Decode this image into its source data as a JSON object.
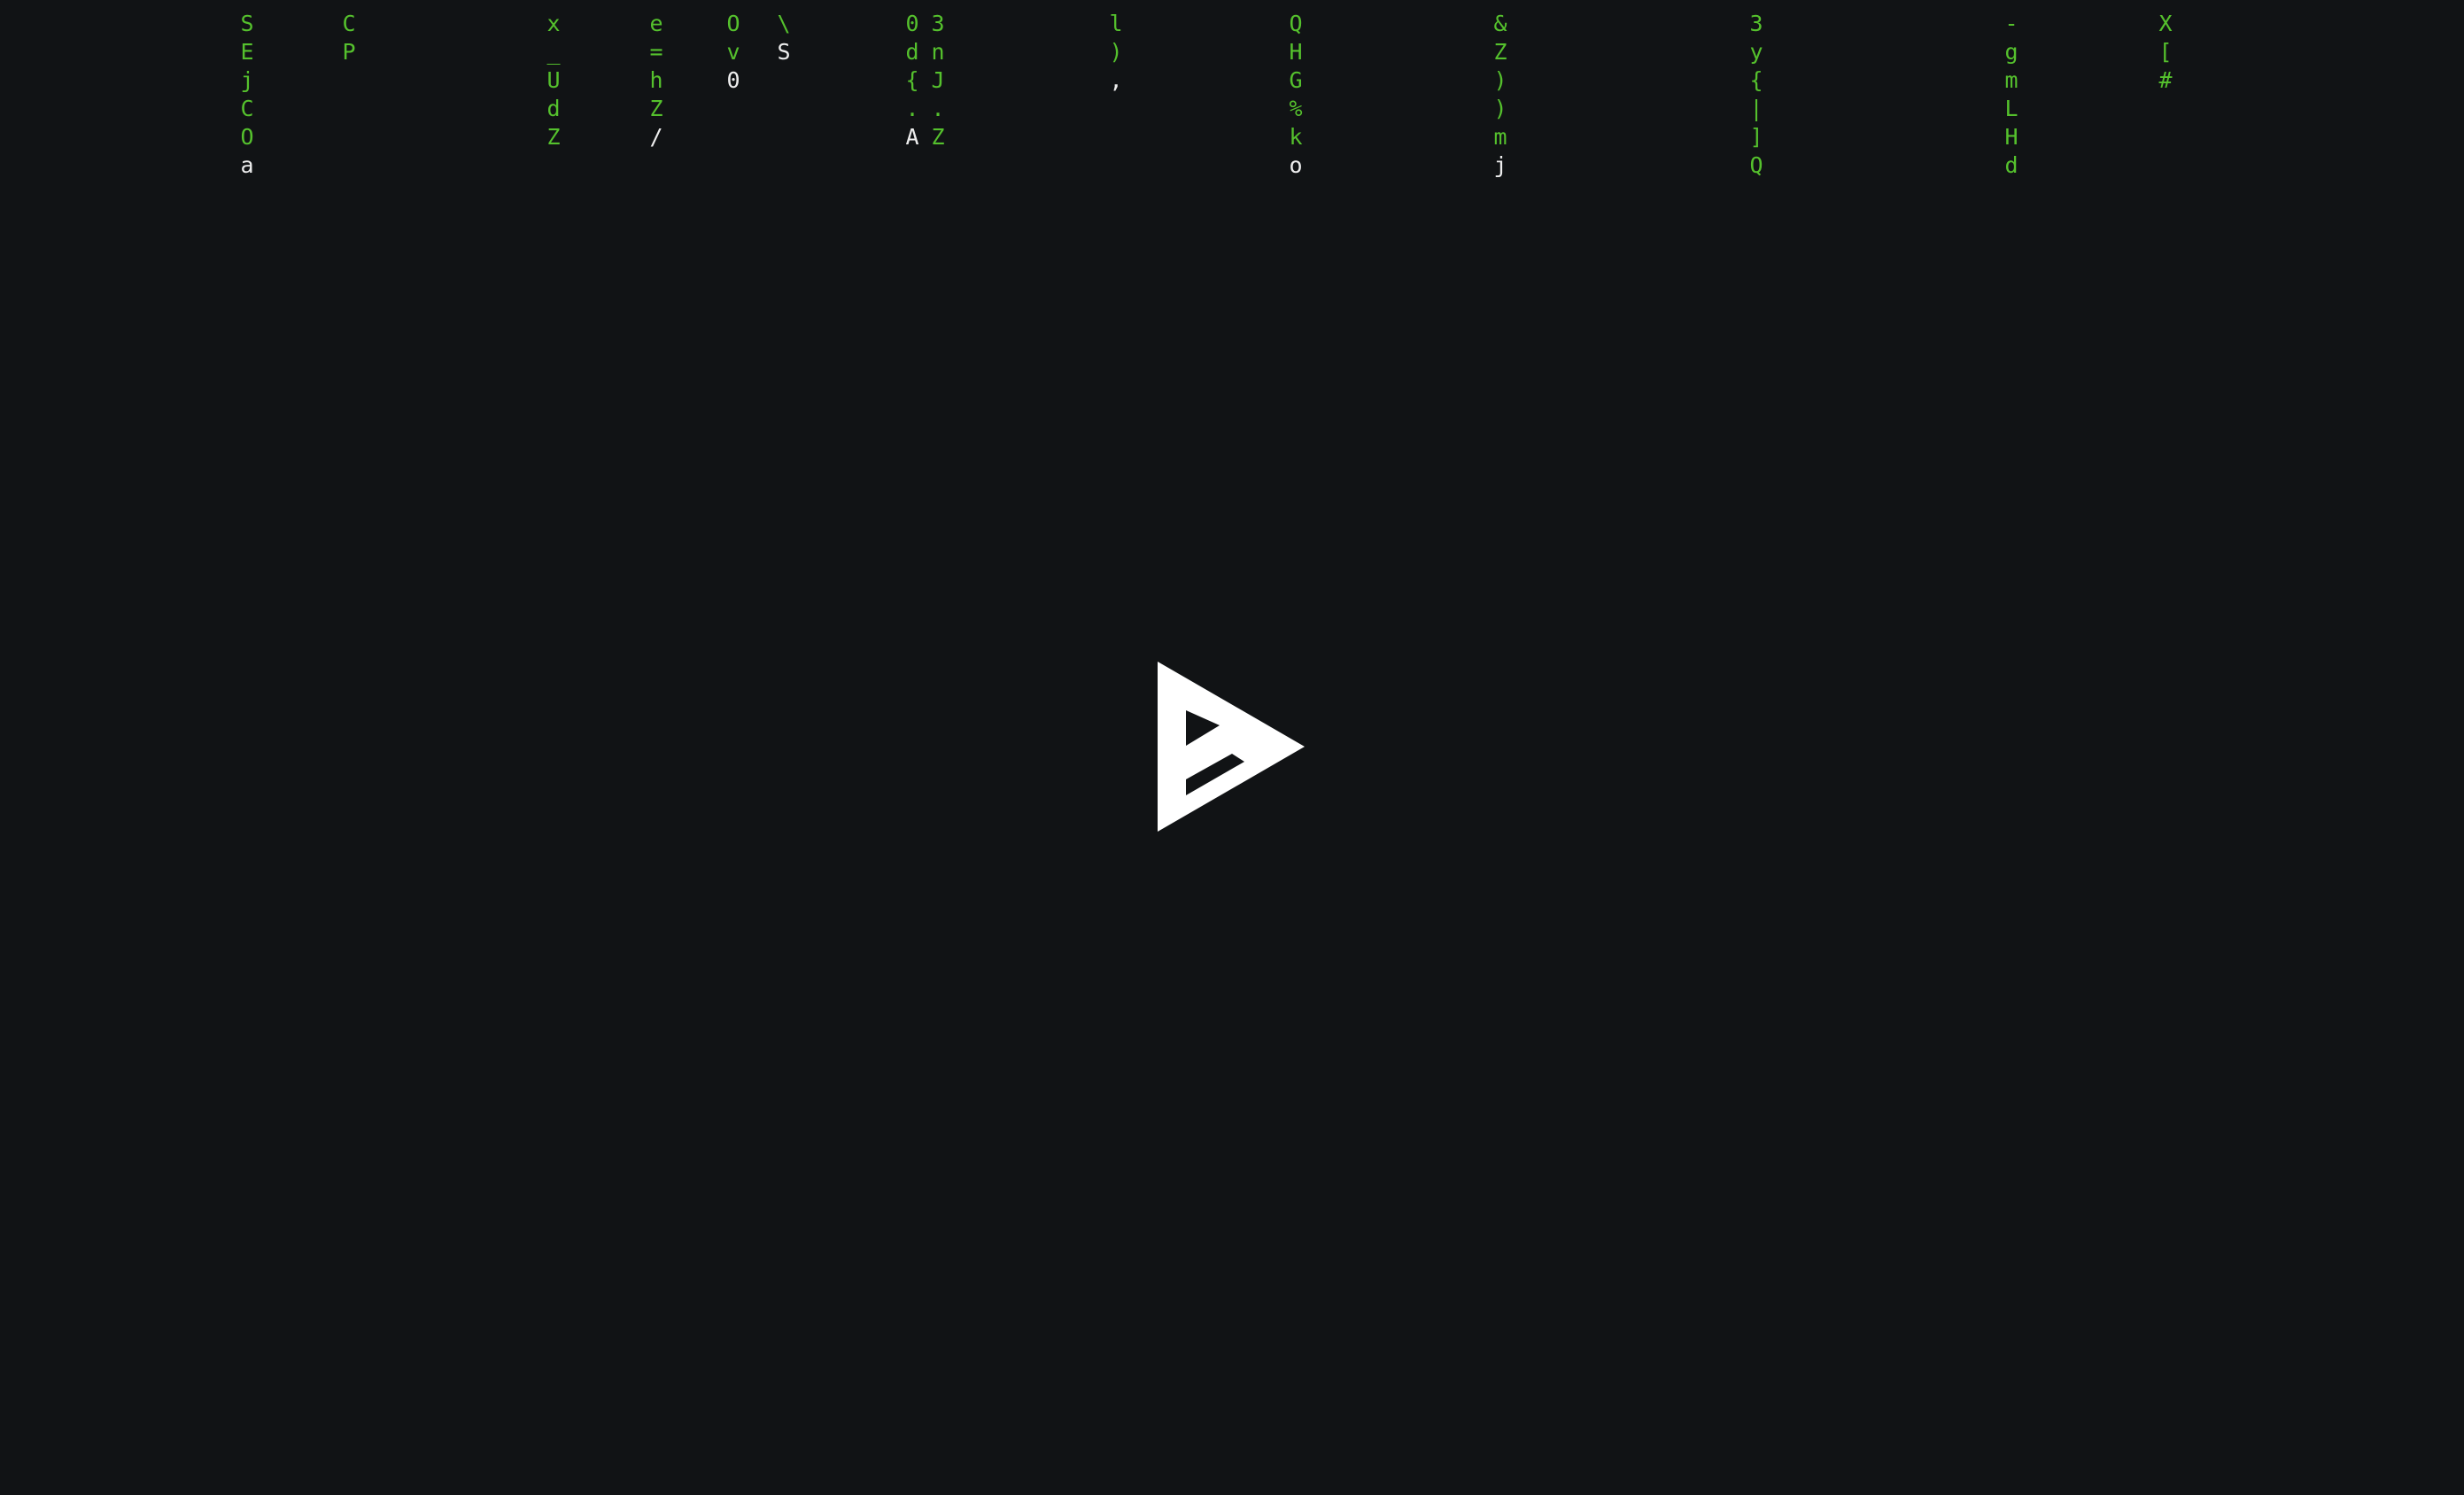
{
  "colors": {
    "background": "#111315",
    "rain_trail": "#55c12d",
    "rain_head": "#eeeeee",
    "logo": "#ffffff"
  },
  "logo": {
    "icon": "asciinema-play-logo-icon"
  },
  "rain": {
    "columns": [
      {
        "trail": [
          "S",
          "E",
          "j",
          "C",
          "O"
        ],
        "head": "a"
      },
      {
        "trail": [
          "C",
          "P"
        ],
        "head": ""
      },
      {
        "trail": [
          "x",
          "_",
          "U",
          "d",
          "Z"
        ],
        "head": ""
      },
      {
        "trail": [
          "e",
          "=",
          "h",
          "Z"
        ],
        "head": "/"
      },
      {
        "trail": [
          "O",
          "v"
        ],
        "head": "0"
      },
      {
        "trail": [
          "\\"
        ],
        "head": "S"
      },
      {
        "trail": [
          "0",
          "d",
          "{",
          "."
        ],
        "head": "A"
      },
      {
        "trail": [
          "3",
          "n",
          "J",
          ".",
          "Z"
        ],
        "head": ""
      },
      {
        "trail": [
          "l",
          ")"
        ],
        "head": ","
      },
      {
        "trail": [
          "Q",
          "H",
          "G",
          "%",
          "k"
        ],
        "head": "o"
      },
      {
        "trail": [
          "&",
          "Z",
          ")",
          ")",
          "m"
        ],
        "head": "j"
      },
      {
        "trail": [
          "3",
          "y",
          "{",
          "|",
          "]",
          "Q"
        ],
        "head": ""
      },
      {
        "trail": [
          "-",
          "g",
          "m",
          "L",
          "H",
          "d"
        ],
        "head": ""
      },
      {
        "trail": [
          "X",
          "[",
          "#"
        ],
        "head": ""
      }
    ]
  }
}
